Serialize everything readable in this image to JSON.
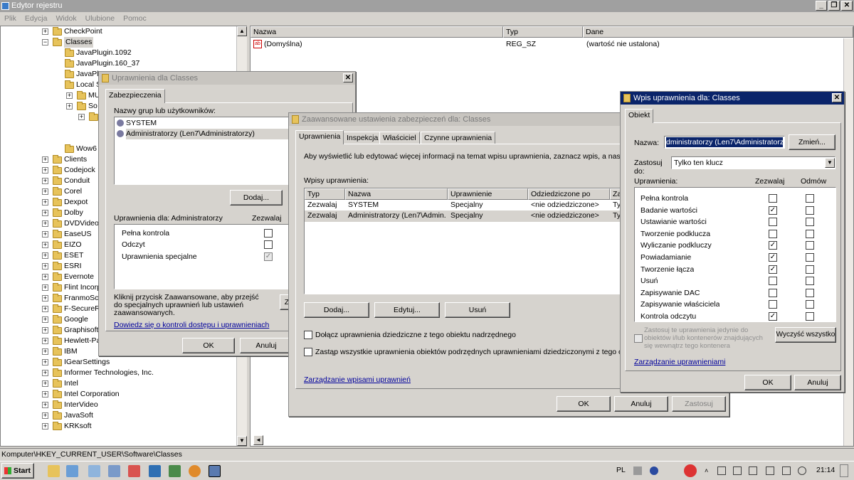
{
  "window": {
    "title": "Edytor rejestru"
  },
  "menu": [
    "Plik",
    "Edycja",
    "Widok",
    "Ulubione",
    "Pomoc"
  ],
  "tree": {
    "items": [
      {
        "label": "CheckPoint",
        "level": 1
      },
      {
        "label": "Classes",
        "level": 1
      },
      {
        "label": "JavaPlugin.1092",
        "level": 2
      },
      {
        "label": "JavaPlugin.160_37",
        "level": 2
      },
      {
        "label": "JavaPl",
        "level": 2
      },
      {
        "label": "Local S",
        "level": 2
      },
      {
        "label": "MU",
        "level": 3
      },
      {
        "label": "So",
        "level": 3
      },
      {
        "label": "",
        "level": 4
      },
      {
        "label": "",
        "level": 5
      },
      {
        "label": "",
        "level": 5
      },
      {
        "label": "Wow6",
        "level": 2
      },
      {
        "label": "Clients",
        "level": 1
      },
      {
        "label": "Codejock",
        "level": 1
      },
      {
        "label": "Conduit",
        "level": 1
      },
      {
        "label": "Corel",
        "level": 1
      },
      {
        "label": "Dexpot",
        "level": 1
      },
      {
        "label": "Dolby",
        "level": 1
      },
      {
        "label": "DVDVideo",
        "level": 1
      },
      {
        "label": "EaseUS",
        "level": 1
      },
      {
        "label": "EIZO",
        "level": 1
      },
      {
        "label": "ESET",
        "level": 1
      },
      {
        "label": "ESRI",
        "level": 1
      },
      {
        "label": "Evernote",
        "level": 1
      },
      {
        "label": "Flint Incorp",
        "level": 1
      },
      {
        "label": "FranmoSc",
        "level": 1
      },
      {
        "label": "F-SecureR",
        "level": 1
      },
      {
        "label": "Google",
        "level": 1
      },
      {
        "label": "Graphisoft",
        "level": 1
      },
      {
        "label": "Hewlett-Pa",
        "level": 1
      },
      {
        "label": "IBM",
        "level": 1
      },
      {
        "label": "IGearSettings",
        "level": 1
      },
      {
        "label": "Informer Technologies, Inc.",
        "level": 1
      },
      {
        "label": "Intel",
        "level": 1
      },
      {
        "label": "Intel Corporation",
        "level": 1
      },
      {
        "label": "InterVideo",
        "level": 1
      },
      {
        "label": "JavaSoft",
        "level": 1
      },
      {
        "label": "KRKsoft",
        "level": 1
      }
    ]
  },
  "list": {
    "headers": [
      "Nazwa",
      "Typ",
      "Dane"
    ],
    "rows": [
      {
        "name": "(Domyślna)",
        "type": "REG_SZ",
        "data": "(wartość nie ustalona)"
      }
    ]
  },
  "status": {
    "path": "Komputer\\HKEY_CURRENT_USER\\Software\\Classes"
  },
  "perm_dialog": {
    "title": "Uprawnienia dla Classes",
    "tab": "Zabezpieczenia",
    "groups_label": "Nazwy grup lub użytkowników:",
    "groups": [
      "SYSTEM",
      "Administratorzy (Len7\\Administratorzy)"
    ],
    "add_button": "Dodaj...",
    "perm_label": "Uprawnienia dla: Administratorzy",
    "allow_col": "Zezwalaj",
    "perms": [
      {
        "label": "Pełna kontrola",
        "allow": false,
        "disabled": false
      },
      {
        "label": "Odczyt",
        "allow": false,
        "disabled": false
      },
      {
        "label": "Uprawnienia specjalne",
        "allow": true,
        "disabled": true
      }
    ],
    "info": "Kliknij przycisk Zaawansowane, aby przejść do specjalnych uprawnień lub ustawień zaawansowanych.",
    "adv_btn_partial": "Z",
    "link": "Dowiedz się o kontroli dostępu i uprawnieniach",
    "ok": "OK",
    "cancel": "Anuluj"
  },
  "adv_dialog": {
    "title": "Zaawansowane ustawienia zabezpieczeń dla: Classes",
    "tabs": [
      "Uprawnienia",
      "Inspekcja",
      "Właściciel",
      "Czynne uprawnienia"
    ],
    "info": "Aby wyświetlić lub edytować więcej informacji na temat wpisu uprawnienia, zaznacz wpis, a następnie",
    "entries_label": "Wpisy uprawnienia:",
    "headers": [
      "Typ",
      "Nazwa",
      "Uprawnienie",
      "Odziedziczone po",
      "Za"
    ],
    "rows": [
      {
        "type": "Zezwalaj",
        "name": "SYSTEM",
        "perm": "Specjalny",
        "inherited": "<nie odziedziczone>",
        "applies": "Ty"
      },
      {
        "type": "Zezwalaj",
        "name": "Administratorzy (Len7\\Admin...",
        "perm": "Specjalny",
        "inherited": "<nie odziedziczone>",
        "applies": "Ty"
      }
    ],
    "add": "Dodaj...",
    "edit": "Edytuj...",
    "remove": "Usuń",
    "check1": "Dołącz uprawnienia dziedziczne z tego obiektu nadrzędnego",
    "check2": "Zastąp wszystkie uprawnienia obiektów podrzędnych uprawnieniami dziedziczonymi z tego obiek",
    "link": "Zarządzanie wpisami uprawnień",
    "ok": "OK",
    "cancel": "Anuluj",
    "apply": "Zastosuj"
  },
  "entry_dialog": {
    "title": "Wpis uprawnienia dla: Classes",
    "tab": "Obiekt",
    "name_label": "Nazwa:",
    "name_value": "dministratorzy (Len7\\Administratorzy)",
    "change_btn": "Zmień...",
    "apply_label": "Zastosuj do:",
    "apply_value": "Tylko ten klucz",
    "perm_col": "Uprawnienia:",
    "allow_col": "Zezwalaj",
    "deny_col": "Odmów",
    "perms": [
      {
        "label": "Pełna kontrola",
        "allow": false,
        "deny": false
      },
      {
        "label": "Badanie wartości",
        "allow": true,
        "deny": false
      },
      {
        "label": "Ustawianie wartości",
        "allow": false,
        "deny": false
      },
      {
        "label": "Tworzenie podklucza",
        "allow": false,
        "deny": false
      },
      {
        "label": "Wyliczanie podkluczy",
        "allow": true,
        "deny": false
      },
      {
        "label": "Powiadamianie",
        "allow": true,
        "deny": false
      },
      {
        "label": "Tworzenie łącza",
        "allow": true,
        "deny": false
      },
      {
        "label": "Usuń",
        "allow": false,
        "deny": false
      },
      {
        "label": "Zapisywanie DAC",
        "allow": false,
        "deny": false
      },
      {
        "label": "Zapisywanie właściciela",
        "allow": false,
        "deny": false
      },
      {
        "label": "Kontrola odczytu",
        "allow": true,
        "deny": false
      }
    ],
    "inherit_text": "Zastosuj te uprawnienia jedynie do obiektów i/lub kontenerów znajdujących się wewnątrz tego kontenera",
    "clear_btn": "Wyczyść wszystko",
    "link": "Zarządzanie uprawnieniami",
    "ok": "OK",
    "cancel": "Anuluj"
  },
  "taskbar": {
    "start": "Start",
    "lang": "PL",
    "time": "21:14"
  }
}
